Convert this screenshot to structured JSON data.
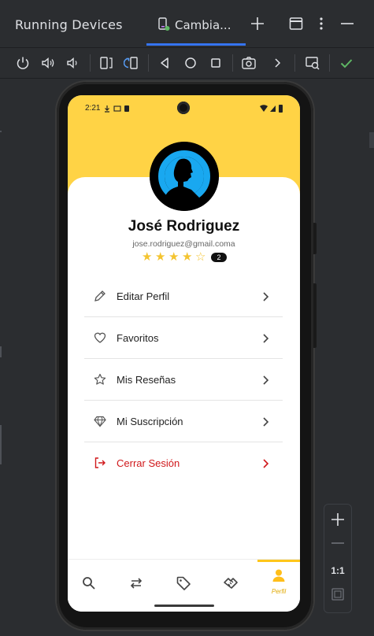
{
  "window": {
    "title": "Running Devices",
    "tab_label": "Cambia..."
  },
  "toolbar": {
    "icons": [
      "power-icon",
      "volume-up-icon",
      "volume-down-icon",
      "rotate-left-icon",
      "rotate-right-icon",
      "back-icon",
      "home-icon",
      "overview-icon",
      "screenshot-icon",
      "more-arrow-icon",
      "screen-record-icon",
      "check-icon"
    ]
  },
  "phone": {
    "status_time": "2:21",
    "profile": {
      "name": "José Rodriguez",
      "email": "jose.rodriguez@gmail.coma",
      "rating_stars": 4,
      "rating_max": 5,
      "review_count": "2"
    },
    "menu": [
      {
        "label": "Editar Perfil",
        "icon": "pencil-icon"
      },
      {
        "label": "Favoritos",
        "icon": "heart-icon"
      },
      {
        "label": "Mis Reseñas",
        "icon": "star-icon"
      },
      {
        "label": "Mi Suscripción",
        "icon": "diamond-icon"
      },
      {
        "label": "Cerrar Sesión",
        "icon": "logout-icon"
      }
    ],
    "bottom_nav": {
      "items": [
        "search-icon",
        "swap-icon",
        "tag-icon",
        "handshake-icon",
        "person-icon"
      ],
      "active_label": "Perfil"
    }
  },
  "zoom": {
    "actual_size_label": "1:1"
  },
  "colors": {
    "accent_yellow": "#ffd345",
    "logout_red": "#d0181b",
    "ide_background": "#2b2d30",
    "tab_underline": "#3574f0",
    "check_green": "#5fb865"
  }
}
